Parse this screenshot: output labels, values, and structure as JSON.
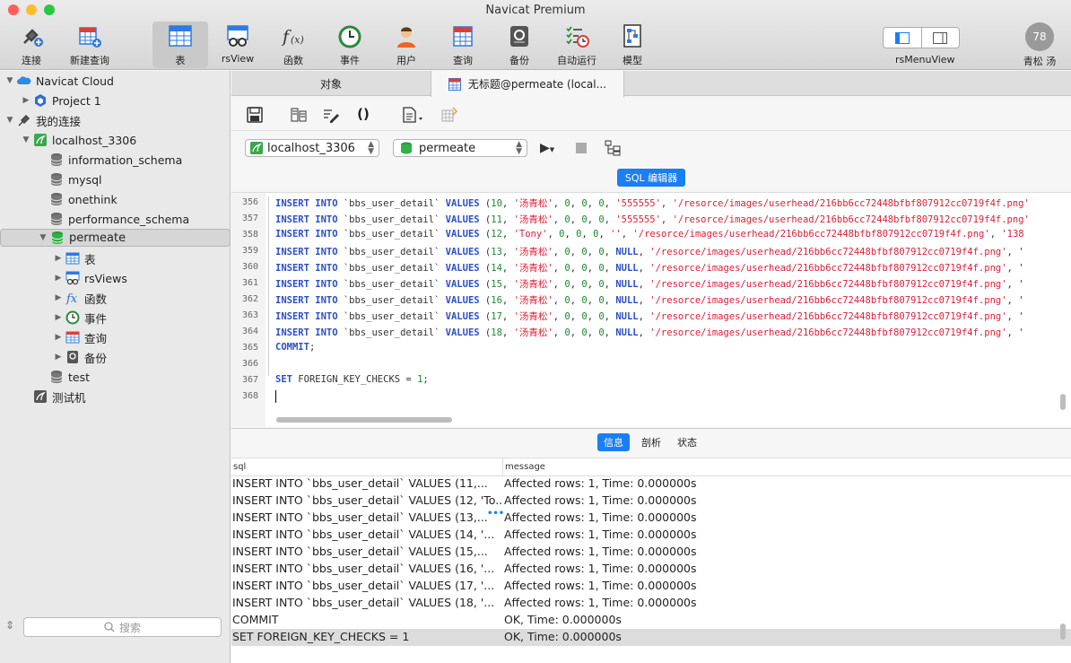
{
  "window": {
    "title": "Navicat Premium"
  },
  "toolbar": {
    "items": [
      {
        "name": "connect",
        "label": "连接"
      },
      {
        "name": "new-query",
        "label": "新建查询"
      },
      {
        "name": "table",
        "label": "表"
      },
      {
        "name": "rsview",
        "label": "rsView"
      },
      {
        "name": "function",
        "label": "函数"
      },
      {
        "name": "event",
        "label": "事件"
      },
      {
        "name": "user",
        "label": "用户"
      },
      {
        "name": "query",
        "label": "查询"
      },
      {
        "name": "backup",
        "label": "备份"
      },
      {
        "name": "automation",
        "label": "自动运行"
      },
      {
        "name": "model",
        "label": "模型"
      }
    ],
    "view_label": "rsMenuView",
    "user_label": "青松 汤",
    "avatar_text": "78"
  },
  "sidebar": {
    "items": [
      {
        "label": "Navicat Cloud",
        "arrow": "▼",
        "icon": "cloud-icon"
      },
      {
        "label": "Project 1",
        "arrow": "▶",
        "icon": "project-icon"
      },
      {
        "label": "我的连接",
        "arrow": "▼",
        "icon": "connections-icon"
      },
      {
        "label": "localhost_3306",
        "arrow": "▼",
        "icon": "mysql-connection-icon"
      },
      {
        "label": "information_schema",
        "arrow": "",
        "icon": "database-icon"
      },
      {
        "label": "mysql",
        "arrow": "",
        "icon": "database-icon"
      },
      {
        "label": "onethink",
        "arrow": "",
        "icon": "database-icon"
      },
      {
        "label": "performance_schema",
        "arrow": "",
        "icon": "database-icon"
      },
      {
        "label": "permeate",
        "arrow": "▼",
        "icon": "database-active-icon"
      },
      {
        "label": "表",
        "arrow": "▶",
        "icon": "table-icon"
      },
      {
        "label": "rsViews",
        "arrow": "▶",
        "icon": "view-icon"
      },
      {
        "label": "函数",
        "arrow": "▶",
        "icon": "function-icon"
      },
      {
        "label": "事件",
        "arrow": "▶",
        "icon": "event-icon"
      },
      {
        "label": "查询",
        "arrow": "▶",
        "icon": "query-icon"
      },
      {
        "label": "备份",
        "arrow": "▶",
        "icon": "backup-icon"
      },
      {
        "label": "test",
        "arrow": "",
        "icon": "database-icon"
      },
      {
        "label": "测试机",
        "arrow": "",
        "icon": "mysql-connection-icon"
      }
    ],
    "search_placeholder": "搜索"
  },
  "tabs": {
    "objects": "对象",
    "query": "无标题@permeate (local..."
  },
  "selectors": {
    "connection": "localhost_3306",
    "database": "permeate",
    "editor_button": "SQL 编辑器"
  },
  "editor": {
    "lines": [
      {
        "n": "356",
        "code": [
          [
            "kw",
            "INSERT INTO "
          ],
          [
            "t",
            "`bbs_user_detail` "
          ],
          [
            "kw",
            "VALUES "
          ],
          [
            "t",
            "("
          ],
          [
            "num",
            "10"
          ],
          [
            "t",
            ", "
          ],
          [
            "str",
            "'汤青松'"
          ],
          [
            "t",
            ", "
          ],
          [
            "num",
            "0"
          ],
          [
            "t",
            ", "
          ],
          [
            "num",
            "0"
          ],
          [
            "t",
            ", "
          ],
          [
            "num",
            "0"
          ],
          [
            "t",
            ", "
          ],
          [
            "str",
            "'555555'"
          ],
          [
            "t",
            ", "
          ],
          [
            "str",
            "'/resorce/images/userhead/216bb6cc72448bfbf807912cc0719f4f.png'"
          ]
        ]
      },
      {
        "n": "357",
        "code": [
          [
            "kw",
            "INSERT INTO "
          ],
          [
            "t",
            "`bbs_user_detail` "
          ],
          [
            "kw",
            "VALUES "
          ],
          [
            "t",
            "("
          ],
          [
            "num",
            "11"
          ],
          [
            "t",
            ", "
          ],
          [
            "str",
            "'汤青松'"
          ],
          [
            "t",
            ", "
          ],
          [
            "num",
            "0"
          ],
          [
            "t",
            ", "
          ],
          [
            "num",
            "0"
          ],
          [
            "t",
            ", "
          ],
          [
            "num",
            "0"
          ],
          [
            "t",
            ", "
          ],
          [
            "str",
            "'555555'"
          ],
          [
            "t",
            ", "
          ],
          [
            "str",
            "'/resorce/images/userhead/216bb6cc72448bfbf807912cc0719f4f.png'"
          ]
        ]
      },
      {
        "n": "358",
        "code": [
          [
            "kw",
            "INSERT INTO "
          ],
          [
            "t",
            "`bbs_user_detail` "
          ],
          [
            "kw",
            "VALUES "
          ],
          [
            "t",
            "("
          ],
          [
            "num",
            "12"
          ],
          [
            "t",
            ", "
          ],
          [
            "str",
            "'Tony'"
          ],
          [
            "t",
            ", "
          ],
          [
            "num",
            "0"
          ],
          [
            "t",
            ", "
          ],
          [
            "num",
            "0"
          ],
          [
            "t",
            ", "
          ],
          [
            "num",
            "0"
          ],
          [
            "t",
            ", "
          ],
          [
            "str",
            "''"
          ],
          [
            "t",
            ", "
          ],
          [
            "str",
            "'/resorce/images/userhead/216bb6cc72448bfbf807912cc0719f4f.png'"
          ],
          [
            "t",
            ", "
          ],
          [
            "str",
            "'138"
          ]
        ]
      },
      {
        "n": "359",
        "code": [
          [
            "kw",
            "INSERT INTO "
          ],
          [
            "t",
            "`bbs_user_detail` "
          ],
          [
            "kw",
            "VALUES "
          ],
          [
            "t",
            "("
          ],
          [
            "num",
            "13"
          ],
          [
            "t",
            ", "
          ],
          [
            "str",
            "'汤青松'"
          ],
          [
            "t",
            ", "
          ],
          [
            "num",
            "0"
          ],
          [
            "t",
            ", "
          ],
          [
            "num",
            "0"
          ],
          [
            "t",
            ", "
          ],
          [
            "num",
            "0"
          ],
          [
            "t",
            ", "
          ],
          [
            "kw",
            "NULL"
          ],
          [
            "t",
            ", "
          ],
          [
            "str",
            "'/resorce/images/userhead/216bb6cc72448bfbf807912cc0719f4f.png'"
          ],
          [
            "t",
            ", '"
          ]
        ]
      },
      {
        "n": "360",
        "code": [
          [
            "kw",
            "INSERT INTO "
          ],
          [
            "t",
            "`bbs_user_detail` "
          ],
          [
            "kw",
            "VALUES "
          ],
          [
            "t",
            "("
          ],
          [
            "num",
            "14"
          ],
          [
            "t",
            ", "
          ],
          [
            "str",
            "'汤青松'"
          ],
          [
            "t",
            ", "
          ],
          [
            "num",
            "0"
          ],
          [
            "t",
            ", "
          ],
          [
            "num",
            "0"
          ],
          [
            "t",
            ", "
          ],
          [
            "num",
            "0"
          ],
          [
            "t",
            ", "
          ],
          [
            "kw",
            "NULL"
          ],
          [
            "t",
            ", "
          ],
          [
            "str",
            "'/resorce/images/userhead/216bb6cc72448bfbf807912cc0719f4f.png'"
          ],
          [
            "t",
            ", '"
          ]
        ]
      },
      {
        "n": "361",
        "code": [
          [
            "kw",
            "INSERT INTO "
          ],
          [
            "t",
            "`bbs_user_detail` "
          ],
          [
            "kw",
            "VALUES "
          ],
          [
            "t",
            "("
          ],
          [
            "num",
            "15"
          ],
          [
            "t",
            ", "
          ],
          [
            "str",
            "'汤青松'"
          ],
          [
            "t",
            ", "
          ],
          [
            "num",
            "0"
          ],
          [
            "t",
            ", "
          ],
          [
            "num",
            "0"
          ],
          [
            "t",
            ", "
          ],
          [
            "num",
            "0"
          ],
          [
            "t",
            ", "
          ],
          [
            "kw",
            "NULL"
          ],
          [
            "t",
            ", "
          ],
          [
            "str",
            "'/resorce/images/userhead/216bb6cc72448bfbf807912cc0719f4f.png'"
          ],
          [
            "t",
            ", '"
          ]
        ]
      },
      {
        "n": "362",
        "code": [
          [
            "kw",
            "INSERT INTO "
          ],
          [
            "t",
            "`bbs_user_detail` "
          ],
          [
            "kw",
            "VALUES "
          ],
          [
            "t",
            "("
          ],
          [
            "num",
            "16"
          ],
          [
            "t",
            ", "
          ],
          [
            "str",
            "'汤青松'"
          ],
          [
            "t",
            ", "
          ],
          [
            "num",
            "0"
          ],
          [
            "t",
            ", "
          ],
          [
            "num",
            "0"
          ],
          [
            "t",
            ", "
          ],
          [
            "num",
            "0"
          ],
          [
            "t",
            ", "
          ],
          [
            "kw",
            "NULL"
          ],
          [
            "t",
            ", "
          ],
          [
            "str",
            "'/resorce/images/userhead/216bb6cc72448bfbf807912cc0719f4f.png'"
          ],
          [
            "t",
            ", '"
          ]
        ]
      },
      {
        "n": "363",
        "code": [
          [
            "kw",
            "INSERT INTO "
          ],
          [
            "t",
            "`bbs_user_detail` "
          ],
          [
            "kw",
            "VALUES "
          ],
          [
            "t",
            "("
          ],
          [
            "num",
            "17"
          ],
          [
            "t",
            ", "
          ],
          [
            "str",
            "'汤青松'"
          ],
          [
            "t",
            ", "
          ],
          [
            "num",
            "0"
          ],
          [
            "t",
            ", "
          ],
          [
            "num",
            "0"
          ],
          [
            "t",
            ", "
          ],
          [
            "num",
            "0"
          ],
          [
            "t",
            ", "
          ],
          [
            "kw",
            "NULL"
          ],
          [
            "t",
            ", "
          ],
          [
            "str",
            "'/resorce/images/userhead/216bb6cc72448bfbf807912cc0719f4f.png'"
          ],
          [
            "t",
            ", '"
          ]
        ]
      },
      {
        "n": "364",
        "code": [
          [
            "kw",
            "INSERT INTO "
          ],
          [
            "t",
            "`bbs_user_detail` "
          ],
          [
            "kw",
            "VALUES "
          ],
          [
            "t",
            "("
          ],
          [
            "num",
            "18"
          ],
          [
            "t",
            ", "
          ],
          [
            "str",
            "'汤青松'"
          ],
          [
            "t",
            ", "
          ],
          [
            "num",
            "0"
          ],
          [
            "t",
            ", "
          ],
          [
            "num",
            "0"
          ],
          [
            "t",
            ", "
          ],
          [
            "num",
            "0"
          ],
          [
            "t",
            ", "
          ],
          [
            "kw",
            "NULL"
          ],
          [
            "t",
            ", "
          ],
          [
            "str",
            "'/resorce/images/userhead/216bb6cc72448bfbf807912cc0719f4f.png'"
          ],
          [
            "t",
            ", '"
          ]
        ]
      },
      {
        "n": "365",
        "code": [
          [
            "kw",
            "COMMIT"
          ],
          [
            "t",
            ";"
          ]
        ]
      },
      {
        "n": "366",
        "code": []
      },
      {
        "n": "367",
        "code": [
          [
            "kw",
            "SET "
          ],
          [
            "t",
            "FOREIGN_KEY_CHECKS = "
          ],
          [
            "num",
            "1"
          ],
          [
            "t",
            ";"
          ]
        ]
      },
      {
        "n": "368",
        "code": []
      }
    ]
  },
  "results": {
    "tabs": [
      "信息",
      "剖析",
      "状态"
    ],
    "columns": [
      "sql",
      "message"
    ],
    "rows": [
      [
        "INSERT INTO `bbs_user_detail` VALUES (11,...",
        "Affected rows: 1, Time: 0.000000s"
      ],
      [
        "INSERT INTO `bbs_user_detail` VALUES (12, 'To...",
        "Affected rows: 1, Time: 0.000000s"
      ],
      [
        "INSERT INTO `bbs_user_detail` VALUES (13,...",
        "Affected rows: 1, Time: 0.000000s"
      ],
      [
        "INSERT INTO `bbs_user_detail` VALUES (14, '...",
        "Affected rows: 1, Time: 0.000000s"
      ],
      [
        "INSERT INTO `bbs_user_detail` VALUES (15,...",
        "Affected rows: 1, Time: 0.000000s"
      ],
      [
        "INSERT INTO `bbs_user_detail` VALUES (16, '...",
        "Affected rows: 1, Time: 0.000000s"
      ],
      [
        "INSERT INTO `bbs_user_detail` VALUES (17, '...",
        "Affected rows: 1, Time: 0.000000s"
      ],
      [
        "INSERT INTO `bbs_user_detail` VALUES (18, '...",
        "Affected rows: 1, Time: 0.000000s"
      ],
      [
        "COMMIT",
        "OK, Time: 0.000000s"
      ],
      [
        "SET FOREIGN_KEY_CHECKS = 1",
        "OK, Time: 0.000000s"
      ]
    ]
  },
  "colors": {
    "accent": "#1a7ef5",
    "keyword": "#2c4ec9",
    "string": "#d9203a",
    "number": "#1a8a2a"
  }
}
